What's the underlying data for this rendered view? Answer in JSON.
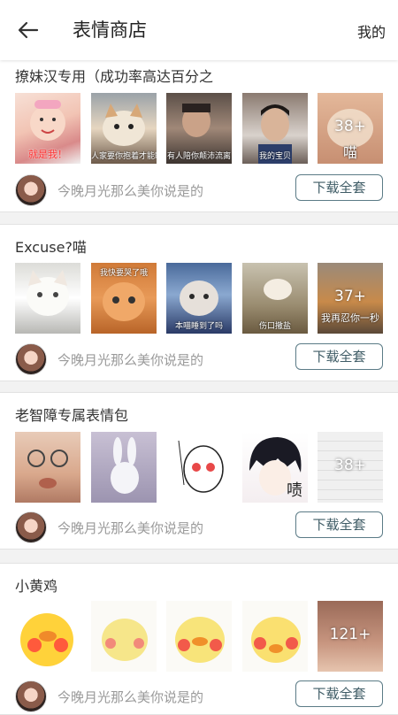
{
  "header": {
    "title": "表情商店",
    "mine_label": "我的"
  },
  "packs": [
    {
      "title": "撩妹汉专用（成功率高达百分之",
      "thumbs": [
        {
          "caption": "就是我！",
          "more": ""
        },
        {
          "caption": "人家要你抱着才能睡",
          "more": ""
        },
        {
          "caption": "有人陪你颠沛流离",
          "more": ""
        },
        {
          "caption": "我的宝贝",
          "more": ""
        },
        {
          "caption": "喵",
          "more": "38+"
        }
      ],
      "author": "今晚月光那么美你说是的",
      "download_label": "下载全套"
    },
    {
      "title": "Excuse?喵",
      "thumbs": [
        {
          "caption": "",
          "more": ""
        },
        {
          "caption": "我快要哭了哦",
          "more": ""
        },
        {
          "caption": "本喵睡到了吗",
          "more": ""
        },
        {
          "caption": "伤口撒盐",
          "more": ""
        },
        {
          "caption": "我再忍你一秒",
          "more": "37+"
        }
      ],
      "author": "今晚月光那么美你说是的",
      "download_label": "下载全套"
    },
    {
      "title": "老智障专属表情包",
      "thumbs": [
        {
          "caption": "",
          "more": ""
        },
        {
          "caption": "",
          "more": ""
        },
        {
          "caption": "",
          "more": ""
        },
        {
          "caption": "啧",
          "more": ""
        },
        {
          "caption": "",
          "more": "38+"
        }
      ],
      "author": "今晚月光那么美你说是的",
      "download_label": "下载全套"
    },
    {
      "title": "小黄鸡",
      "thumbs": [
        {
          "caption": "",
          "more": ""
        },
        {
          "caption": "",
          "more": ""
        },
        {
          "caption": "",
          "more": ""
        },
        {
          "caption": "",
          "more": ""
        },
        {
          "caption": "",
          "more": "121+"
        }
      ],
      "author": "今晚月光那么美你说是的",
      "download_label": "下载全套"
    }
  ]
}
